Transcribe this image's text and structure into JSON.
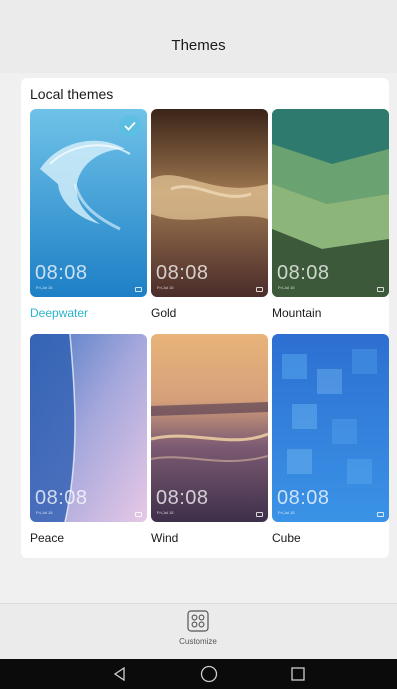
{
  "header": {
    "title": "Themes"
  },
  "section": {
    "title": "Local themes"
  },
  "themes": [
    {
      "name": "Deepwater",
      "clock": "08:08",
      "date": "Fri,Jul 15",
      "selected": true
    },
    {
      "name": "Gold",
      "clock": "08:08",
      "date": "Fri,Jul 15",
      "selected": false
    },
    {
      "name": "Mountain",
      "clock": "08:08",
      "date": "Fri,Jul 15",
      "selected": false
    },
    {
      "name": "Peace",
      "clock": "08:08",
      "date": "Fri,Jul 15",
      "selected": false
    },
    {
      "name": "Wind",
      "clock": "08:08",
      "date": "Fri,Jul 15",
      "selected": false
    },
    {
      "name": "Cube",
      "clock": "08:08",
      "date": "Fri,Jul 15",
      "selected": false
    }
  ],
  "bottom": {
    "customize_label": "Customize",
    "customize_icon": "customize-grid-icon"
  },
  "nav": {
    "back_icon": "back-triangle-icon",
    "home_icon": "home-circle-icon",
    "recents_icon": "recents-square-icon"
  },
  "colors": {
    "selected_accent": "#2ab5c9",
    "check_badge": "#5abee1",
    "navbar": "#0b0b0b"
  }
}
